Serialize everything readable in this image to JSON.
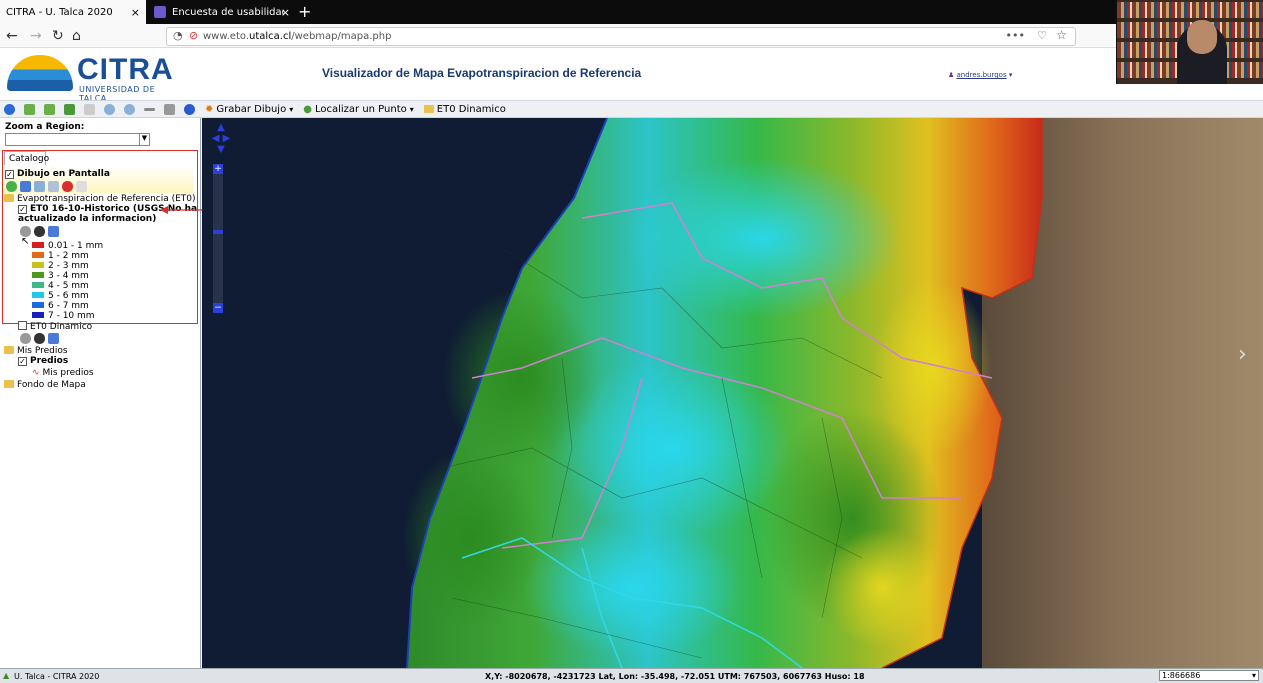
{
  "browser": {
    "tabs": [
      {
        "label": "CITRA - U. Talca 2020",
        "active": true
      },
      {
        "label": "Encuesta de usabilidad Platafo",
        "active": false
      }
    ],
    "url_prefix": "www.eto.",
    "url_domain": "utalca.cl",
    "url_path": "/webmap/mapa.php"
  },
  "header": {
    "logo_name": "CITRA",
    "logo_sub": "UNIVERSIDAD DE TALCA",
    "title": "Visualizador de Mapa Evapotranspiracion de Referencia",
    "user": "andres.burgos"
  },
  "toolbar": {
    "grabar": "Grabar Dibujo",
    "localizar": "Localizar un Punto",
    "et0_dinamico": "ET0 Dinamico"
  },
  "sidebar": {
    "zoom_label": "Zoom a Region:",
    "catalog_tab": "Catalogo",
    "dibujo": "Dibujo en Pantalla",
    "et0_folder": "Evapotranspiracion de Referencia (ET0)",
    "et0_layer_line1": "ET0 16-10-Historico (USGS No ha",
    "et0_layer_line2": "actualizado la informacion)",
    "legend": [
      {
        "label": "0.01 - 1 mm",
        "color": "#d71e1e"
      },
      {
        "label": "1 - 2 mm",
        "color": "#e06a1a"
      },
      {
        "label": "2 - 3 mm",
        "color": "#c9c21a"
      },
      {
        "label": "3 - 4 mm",
        "color": "#4a9a1e"
      },
      {
        "label": "4 - 5 mm",
        "color": "#3fb88a"
      },
      {
        "label": "5 - 6 mm",
        "color": "#22c8e8"
      },
      {
        "label": "6 - 7 mm",
        "color": "#1a6ad8"
      },
      {
        "label": "7 - 10 mm",
        "color": "#1620b8"
      }
    ],
    "et0_dinamico": "ET0 Dinamico",
    "mis_predios": "Mis Predios",
    "predios": "Predios",
    "mis_predios_item": "Mis predios",
    "fondo": "Fondo de Mapa"
  },
  "status": {
    "left": "U. Talca - CITRA 2020",
    "coords": "X,Y: -8020678, -4231723  Lat, Lon: -35.498, -72.051  UTM: 767503, 6067763 Huso: 18",
    "scale": "1:866686"
  }
}
